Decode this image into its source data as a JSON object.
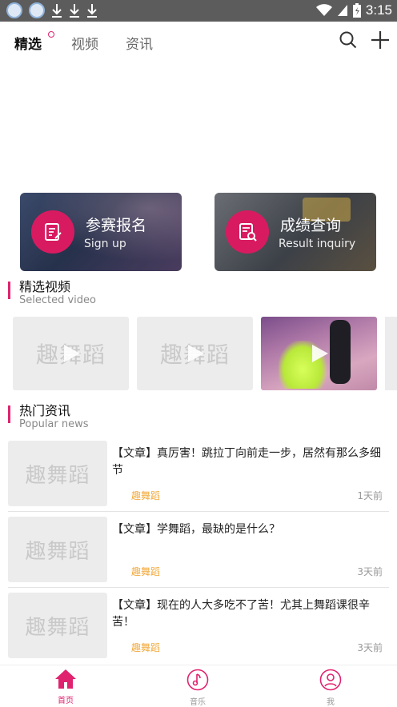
{
  "status_bar": {
    "time": "3:15"
  },
  "header": {
    "tabs": [
      {
        "label": "精选"
      },
      {
        "label": "视频"
      },
      {
        "label": "资讯"
      }
    ]
  },
  "cards": [
    {
      "title": "参赛报名",
      "subtitle": "Sign up"
    },
    {
      "title": "成绩查询",
      "subtitle": "Result inquiry"
    }
  ],
  "videos_section": {
    "title": "精选视频",
    "subtitle": "Selected video",
    "placeholder": "趣舞蹈"
  },
  "news_section": {
    "title": "热门资讯",
    "subtitle": "Popular news",
    "placeholder": "趣舞蹈",
    "items": [
      {
        "title": "【文章】真厉害！跳拉丁向前走一步，居然有那么多细节",
        "source": "趣舞蹈",
        "time": "1天前"
      },
      {
        "title": "【文章】学舞蹈，最缺的是什么？",
        "source": "趣舞蹈",
        "time": "3天前"
      },
      {
        "title": "【文章】现在的人大多吃不了苦！尤其上舞蹈课很辛苦！",
        "source": "趣舞蹈",
        "time": "3天前"
      }
    ]
  },
  "bottom_nav": [
    {
      "label": "首页",
      "icon": "home-icon"
    },
    {
      "label": "音乐",
      "icon": "music-icon"
    },
    {
      "label": "我",
      "icon": "user-icon"
    }
  ],
  "colors": {
    "accent": "#e0236f",
    "source": "#f2a93b"
  }
}
